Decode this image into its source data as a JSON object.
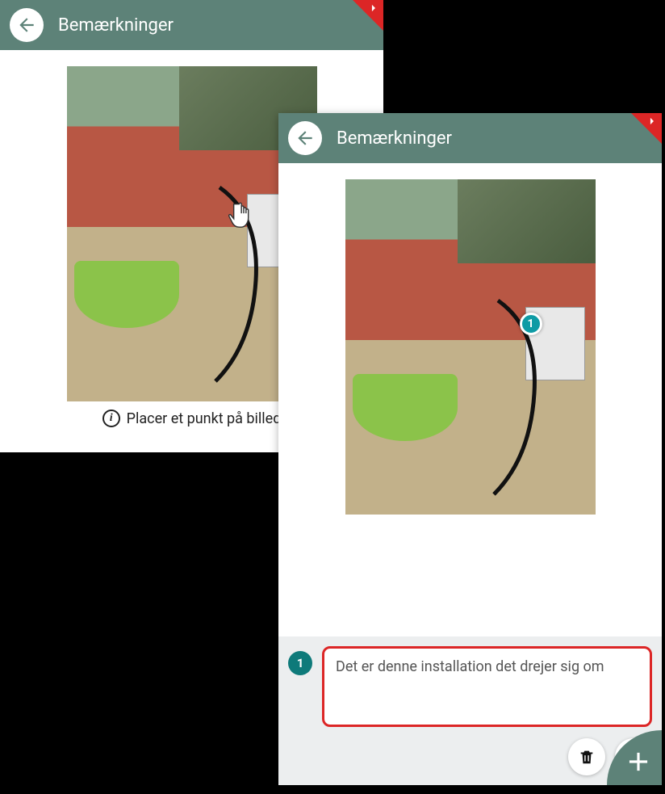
{
  "panel1": {
    "title": "Bemærkninger",
    "info_text": "Placer et punkt på billed"
  },
  "panel2": {
    "title": "Bemærkninger",
    "marker_number": "1",
    "note_number": "1",
    "note_text": "Det er denne installation det drejer sig om"
  }
}
